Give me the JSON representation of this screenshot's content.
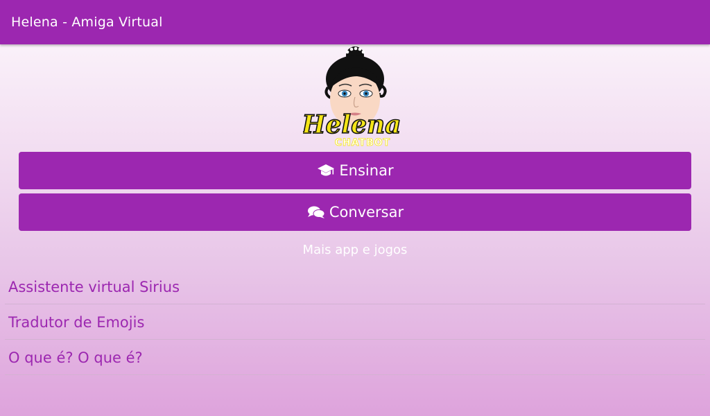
{
  "appbar": {
    "title": "Helena - Amiga Virtual"
  },
  "logo": {
    "name": "Helena",
    "tagline": "CHATBOT"
  },
  "buttons": {
    "teach": {
      "label": "Ensinar",
      "icon": "graduation-cap-icon"
    },
    "chat": {
      "label": "Conversar",
      "icon": "chat-bubbles-icon"
    }
  },
  "more_title": "Mais app e jogos",
  "apps": [
    {
      "label": "Assistente virtual Sirius"
    },
    {
      "label": "Tradutor de Emojis"
    },
    {
      "label": "O que é? O que é?"
    }
  ],
  "colors": {
    "primary": "#9c27b0",
    "background_top": "#fdf9fd",
    "background_bottom": "#dea3dc",
    "logo_text": "#f5e617"
  }
}
